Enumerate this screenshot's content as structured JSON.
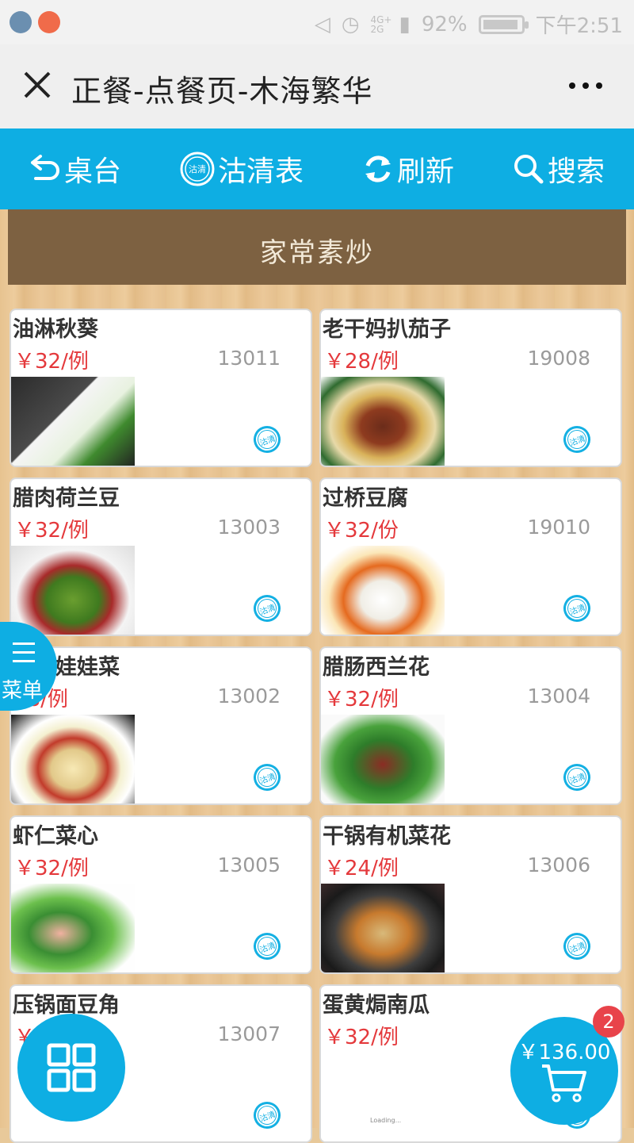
{
  "status_bar": {
    "network": "4G+ 2G",
    "battery": "92%",
    "time": "下午2:51"
  },
  "titlebar": {
    "title": "正餐-点餐页-木海繁华"
  },
  "toolbar": {
    "items": [
      {
        "label": "桌台",
        "icon": "back-arrow-icon"
      },
      {
        "label": "沽清表",
        "icon": "guqing-icon"
      },
      {
        "label": "刷新",
        "icon": "refresh-icon"
      },
      {
        "label": "搜索",
        "icon": "search-icon"
      }
    ]
  },
  "category": {
    "title": "家常素炒"
  },
  "stamp_text": "沽清",
  "dishes": [
    {
      "name": "油淋秋葵",
      "price": "￥32/例",
      "code": "13011"
    },
    {
      "name": "老干妈扒茄子",
      "price": "￥28/例",
      "code": "19008"
    },
    {
      "name": "腊肉荷兰豆",
      "price": "￥32/例",
      "code": "13003"
    },
    {
      "name": "过桥豆腐",
      "price": "￥32/份",
      "code": "19010"
    },
    {
      "name": "粉丝娃娃菜",
      "price": "28/例",
      "code": "13002"
    },
    {
      "name": "腊肠西兰花",
      "price": "￥32/例",
      "code": "13004"
    },
    {
      "name": "虾仁菜心",
      "price": "￥32/例",
      "code": "13005"
    },
    {
      "name": "干锅有机菜花",
      "price": "￥24/例",
      "code": "13006"
    },
    {
      "name": "压锅面豆角",
      "price": "￥",
      "code": "13007"
    },
    {
      "name": "蛋黄焗南瓜",
      "price": "￥32/例",
      "code": ""
    }
  ],
  "loading_text": "Loading...",
  "menu_fab": {
    "label": "菜单"
  },
  "cart": {
    "total": "￥136.00",
    "count": "2"
  },
  "colors": {
    "accent": "#0eaee3",
    "price": "#e4393c",
    "category_bg": "#7d6141",
    "badge": "#e8434a"
  }
}
